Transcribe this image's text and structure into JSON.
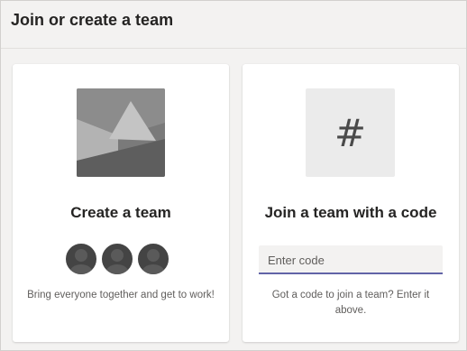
{
  "header": {
    "title": "Join or create a team"
  },
  "create_card": {
    "title": "Create a team",
    "description": "Bring everyone together and get to work!",
    "illustration_icon": "mountain-image-icon",
    "avatar_count": 3
  },
  "join_card": {
    "title": "Join a team with a code",
    "icon": "hash-icon",
    "icon_glyph": "#",
    "input_placeholder": "Enter code",
    "input_value": "",
    "description": "Got a code to join a team? Enter it above."
  },
  "colors": {
    "background": "#f3f2f1",
    "card": "#ffffff",
    "accent": "#6264a7",
    "text_primary": "#252423",
    "text_secondary": "#605e5c"
  }
}
